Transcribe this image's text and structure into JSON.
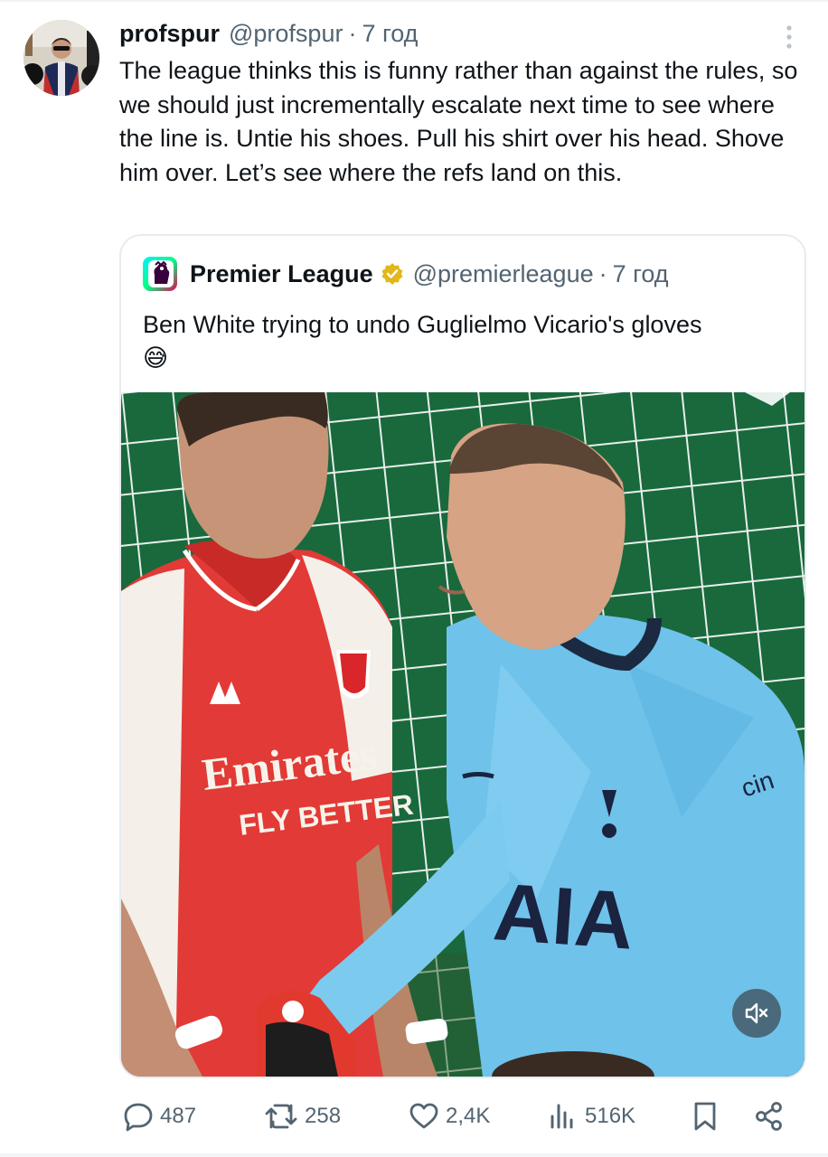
{
  "tweet": {
    "display_name": "profspur",
    "handle": "@profspur",
    "separator": "·",
    "time": "7 год",
    "text": "The league thinks this is funny rather than against the rules, so we should just incrementally escalate next time to see where the line is. Untie his shoes. Pull his shirt over his head. Shove him over. Let’s see where the refs land on this."
  },
  "quoted": {
    "display_name": "Premier League",
    "handle": "@premierleague",
    "separator": "·",
    "time": "7 год",
    "text": "Ben White trying to undo Guglielmo Vicario's gloves",
    "emoji": "😅",
    "jersey_left": [
      "Emirates",
      "FLY BETTER"
    ],
    "jersey_right": [
      "AIA",
      "cin"
    ]
  },
  "actions": {
    "replies": "487",
    "reposts": "258",
    "likes": "2,4K",
    "views": "516K"
  },
  "icons": {
    "more": "more-vertical-icon",
    "verified": "verified-gold-badge-icon",
    "mute": "volume-muted-icon",
    "reply": "reply-icon",
    "repost": "repost-icon",
    "like": "heart-icon",
    "views": "views-chart-icon",
    "bookmark": "bookmark-icon",
    "share": "share-icon"
  },
  "colors": {
    "text_primary": "#0f1419",
    "text_secondary": "#536471",
    "verified_gold": "#e2b719",
    "border": "#e6ecf0"
  }
}
